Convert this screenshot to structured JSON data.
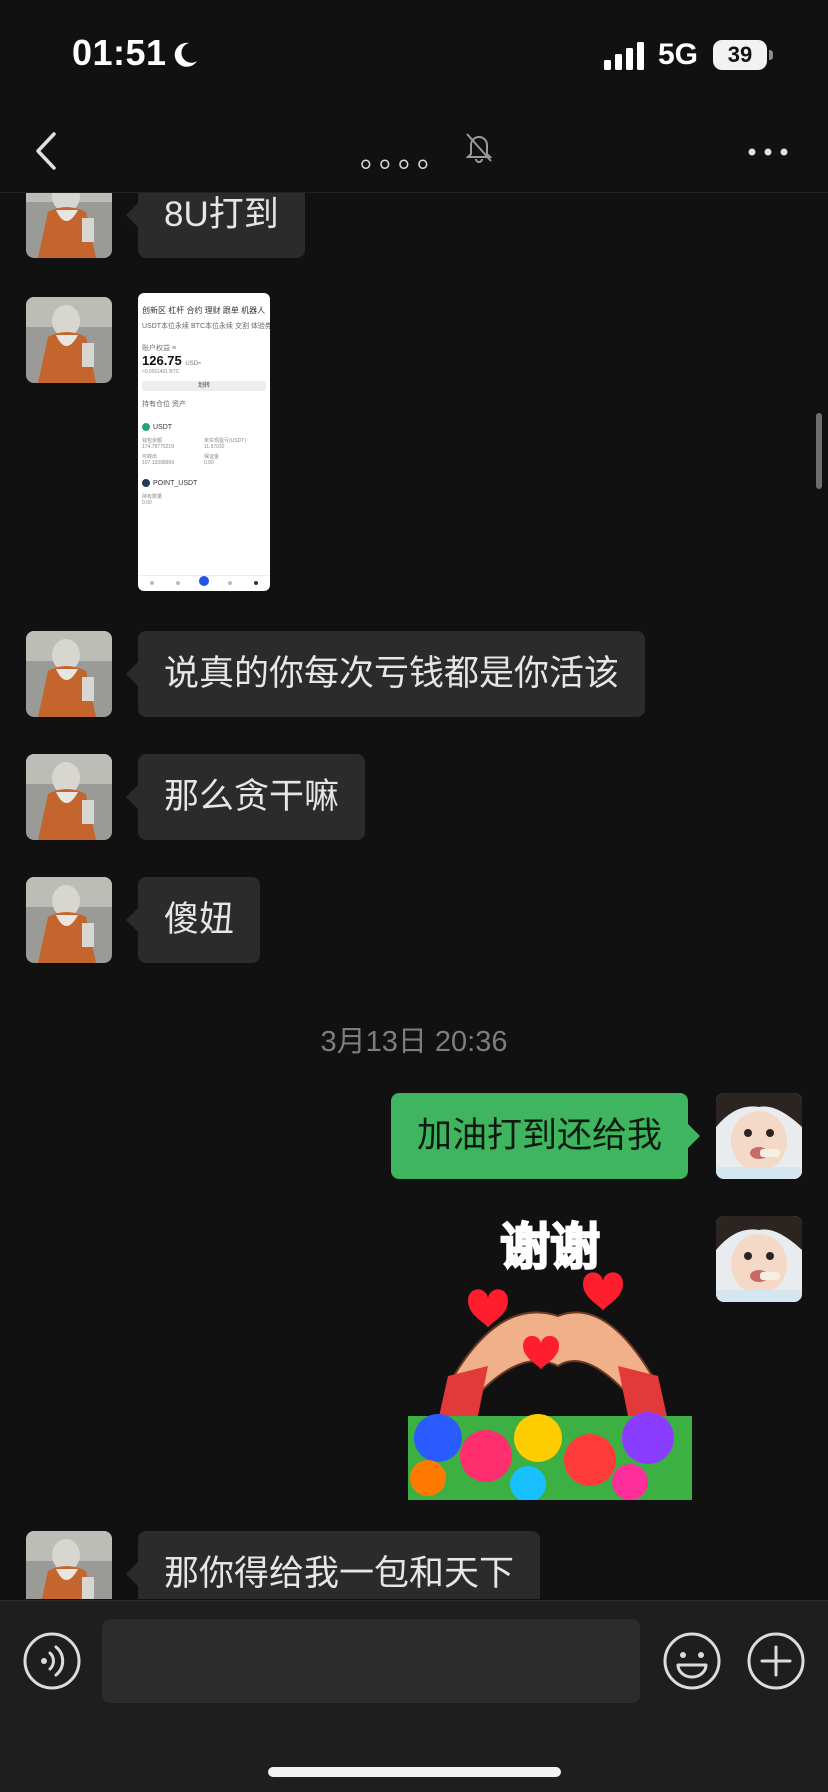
{
  "status_bar": {
    "time": "01:51",
    "network": "5G",
    "battery": "39"
  },
  "nav": {
    "title": "。。。。"
  },
  "messages": [
    {
      "text": "8U打到"
    },
    {
      "text": "说真的你每次亏钱都是你活该"
    },
    {
      "text": "那么贪干嘛"
    },
    {
      "text": "傻妞"
    },
    {
      "text": "加油打到还给我"
    },
    {
      "text": "那你得给我一包和天下"
    }
  ],
  "timestamp": "3月13日 20:36",
  "screenshot_thumb": {
    "tabs": "创新区  杠杆  合约  理财  跟单  机器人",
    "subtabs": "USDT本位永续   BTC本位永续   交割   体验券",
    "label": "账户权益 ≡",
    "value": "126.75",
    "value_unit": "USD≈",
    "btc_line": "≈0.0011401 BTC",
    "button": "划转",
    "asset_tabs": "持有仓位   资产",
    "coin1": "USDT",
    "coin2": "POINT_USDT",
    "small1": "钱包余额",
    "small2": "174.78775219",
    "small3": "未实现盈亏(USDT)",
    "small4": "11.97032",
    "small5": "可转出",
    "small6": "107.13398999",
    "small7": "保证金",
    "small8": "0.00",
    "small9": "持有数量",
    "small10": "0.00"
  },
  "sticker": {
    "text": "谢谢"
  },
  "input": {
    "placeholder": ""
  },
  "colors": {
    "background": "#111111",
    "bubble_in": "#2b2b2b",
    "bubble_out": "#3eb55e",
    "input_bar": "#1e1e1e"
  },
  "icons": {
    "back": "chevron-left-icon",
    "mute": "bell-slash-icon",
    "more": "more-dots-icon",
    "voice": "voice-icon",
    "emoji": "emoji-icon",
    "plus": "plus-circle-icon",
    "moon": "moon-icon",
    "signal": "signal-icon"
  }
}
